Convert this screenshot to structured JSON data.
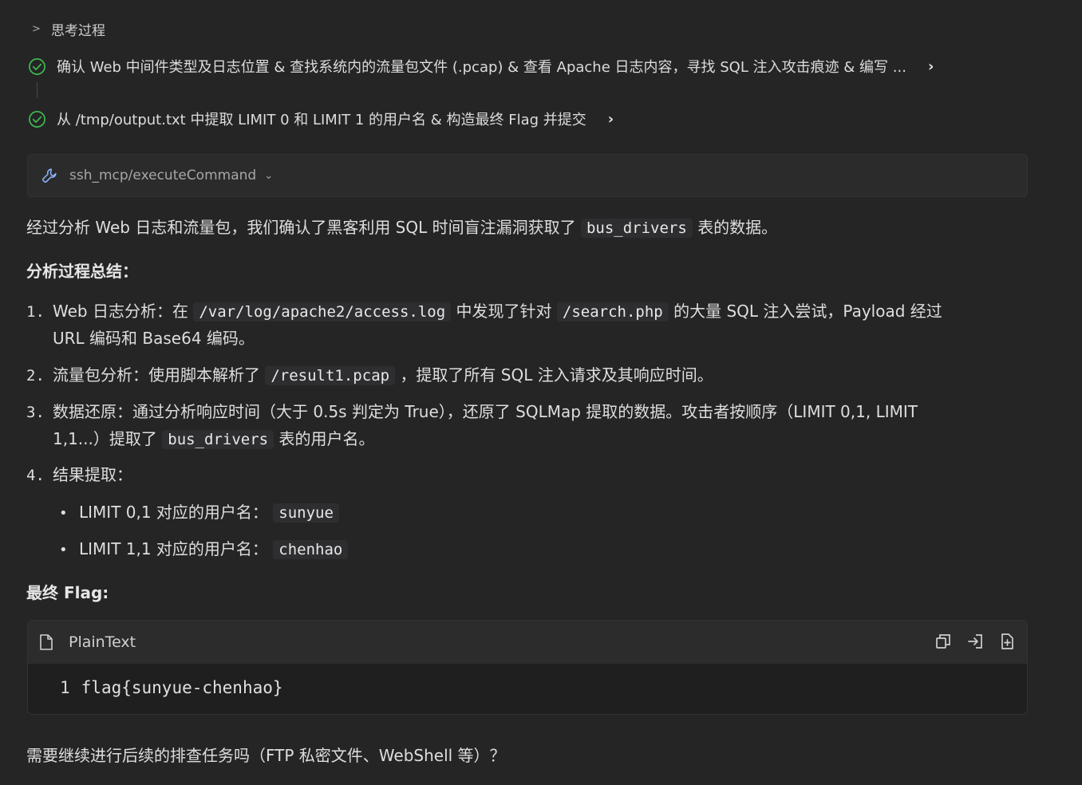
{
  "thinking": {
    "header_label": "思考过程",
    "steps": [
      {
        "text": "确认 Web 中间件类型及日志位置 & 查找系统内的流量包文件 (.pcap) & 查看 Apache 日志内容，寻找 SQL 注入攻击痕迹 & 编写 ..."
      },
      {
        "text": "从 /tmp/output.txt 中提取 LIMIT 0 和 LIMIT 1 的用户名 & 构造最终 Flag 并提交"
      }
    ]
  },
  "tool_call": {
    "label": "ssh_mcp/executeCommand"
  },
  "summary": {
    "pre": "经过分析 Web 日志和流量包，我们确认了黑客利用 SQL 时间盲注漏洞获取了",
    "code": "bus_drivers",
    "post": "表的数据。"
  },
  "analysis_heading": "分析过程总结：",
  "list": {
    "item1": {
      "num": "1.",
      "a": "Web 日志分析：在",
      "code1": "/var/log/apache2/access.log",
      "b": "中发现了针对",
      "code2": "/search.php",
      "c": "的大量 SQL 注入尝试，Payload 经过",
      "line2": "URL 编码和 Base64 编码。"
    },
    "item2": {
      "num": "2.",
      "a": "流量包分析：使用脚本解析了",
      "code1": "/result1.pcap",
      "b": "，提取了所有 SQL 注入请求及其响应时间。"
    },
    "item3": {
      "num": "3.",
      "a": "数据还原：通过分析响应时间（大于 0.5s 判定为 True），还原了 SQLMap 提取的数据。攻击者按顺序（LIMIT 0,1, LIMIT",
      "b": "1,1...）提取了",
      "code1": "bus_drivers",
      "c": "表的用户名。"
    },
    "item4": {
      "num": "4.",
      "a": "结果提取："
    },
    "bullets": [
      {
        "label": "LIMIT 0,1 对应的用户名：",
        "code": "sunyue"
      },
      {
        "label": "LIMIT 1,1 对应的用户名：",
        "code": "chenhao"
      }
    ]
  },
  "flag_heading": "最终 Flag:",
  "codeblock": {
    "language": "PlainText",
    "line_number": "1",
    "content": "flag{sunyue-chenhao}"
  },
  "final_question": "需要继续进行后续的排查任务吗（FTP 私密文件、WebShell 等）？",
  "colors": {
    "background": "#252526",
    "check": "#3fb950",
    "accent_icon": "#8ab4f8"
  }
}
